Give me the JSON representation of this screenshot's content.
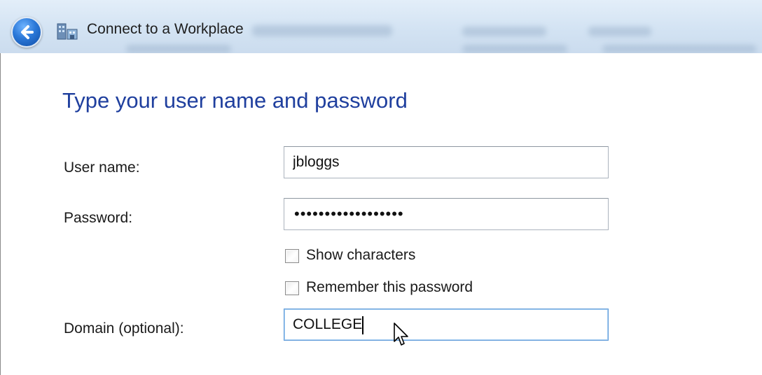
{
  "window": {
    "title": "Connect to a Workplace",
    "back_icon": "back-arrow-icon",
    "app_icon": "network-workplace-icon"
  },
  "form": {
    "heading": "Type your user name and password",
    "username_label": "User name:",
    "username_value": "jbloggs",
    "password_label": "Password:",
    "password_value": "••••••••••••••••••",
    "show_characters_label": "Show characters",
    "show_characters_checked": false,
    "remember_password_label": "Remember this password",
    "remember_password_checked": false,
    "domain_label": "Domain (optional):",
    "domain_value": "COLLEGE"
  },
  "colors": {
    "heading": "#1f3f9e",
    "titlebar": "#d3e3f3",
    "focus_border": "#5f9bd9"
  }
}
